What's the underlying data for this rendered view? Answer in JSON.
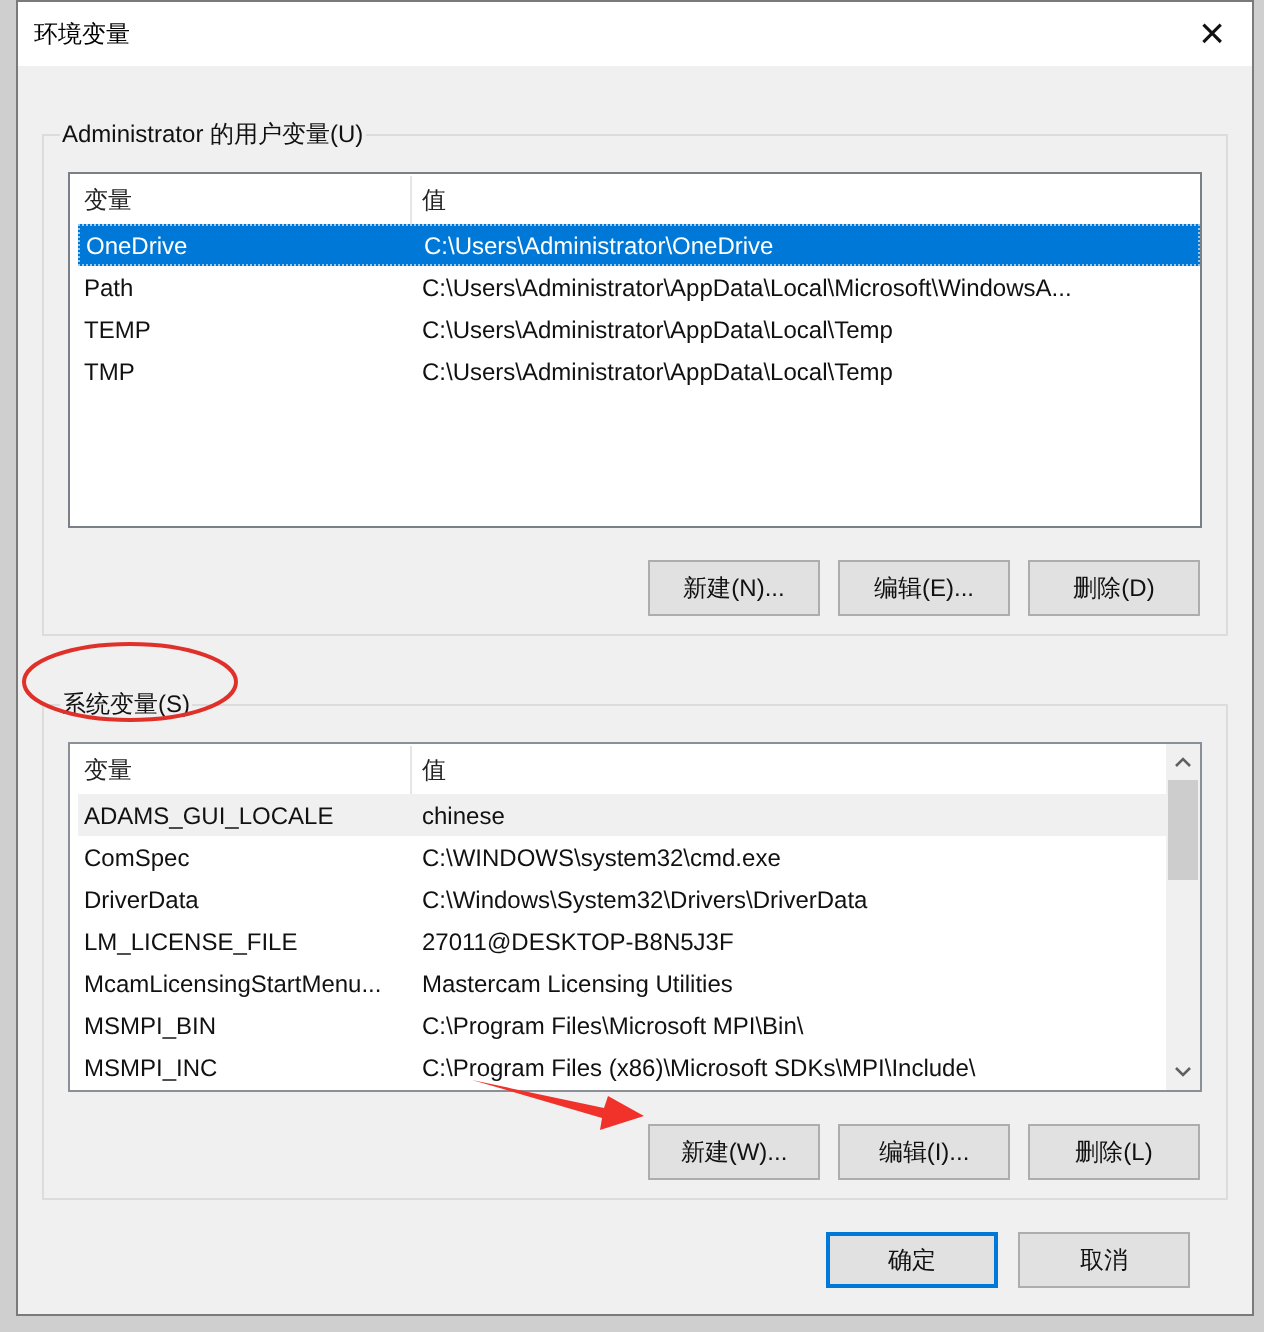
{
  "window": {
    "title": "环境变量",
    "close": "×"
  },
  "user_vars": {
    "label": "Administrator 的用户变量(U)",
    "columns": [
      "变量",
      "值"
    ],
    "focused": true,
    "scrollbar": false,
    "rows": [
      {
        "name": "OneDrive",
        "value": "C:\\Users\\Administrator\\OneDrive",
        "selected": true
      },
      {
        "name": "Path",
        "value": "C:\\Users\\Administrator\\AppData\\Local\\Microsoft\\WindowsA...",
        "selected": false
      },
      {
        "name": "TEMP",
        "value": "C:\\Users\\Administrator\\AppData\\Local\\Temp",
        "selected": false
      },
      {
        "name": "TMP",
        "value": "C:\\Users\\Administrator\\AppData\\Local\\Temp",
        "selected": false
      }
    ],
    "buttons": [
      "新建(N)...",
      "编辑(E)...",
      "删除(D)"
    ]
  },
  "system_vars": {
    "label": "系统变量(S)",
    "columns": [
      "变量",
      "值"
    ],
    "focused": false,
    "scrollbar": true,
    "rows": [
      {
        "name": "ADAMS_GUI_LOCALE",
        "value": "chinese",
        "selected": true
      },
      {
        "name": "ComSpec",
        "value": "C:\\WINDOWS\\system32\\cmd.exe",
        "selected": false
      },
      {
        "name": "DriverData",
        "value": "C:\\Windows\\System32\\Drivers\\DriverData",
        "selected": false
      },
      {
        "name": "LM_LICENSE_FILE",
        "value": "27011@DESKTOP-B8N5J3F",
        "selected": false
      },
      {
        "name": "McamLicensingStartMenu...",
        "value": "Mastercam Licensing Utilities",
        "selected": false
      },
      {
        "name": "MSMPI_BIN",
        "value": "C:\\Program Files\\Microsoft MPI\\Bin\\",
        "selected": false
      },
      {
        "name": "MSMPI_INC",
        "value": "C:\\Program Files (x86)\\Microsoft SDKs\\MPI\\Include\\",
        "selected": false
      }
    ],
    "buttons": [
      "新建(W)...",
      "编辑(I)...",
      "删除(L)"
    ]
  },
  "footer_buttons": [
    {
      "label": "确定",
      "default": true
    },
    {
      "label": "取消",
      "default": false
    }
  ]
}
